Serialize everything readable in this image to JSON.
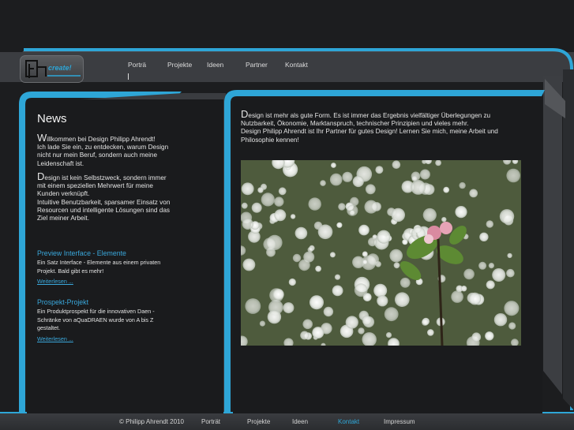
{
  "logo": {
    "text": "create!"
  },
  "topnav": {
    "items": [
      "Porträ",
      "Projekte",
      "Ideen",
      "Partner",
      "Kontakt"
    ]
  },
  "news": {
    "title": "News",
    "intro_p1_cap": "W",
    "intro_p1": "illkommen bei Design Philipp Ahrendt!\nIch lade Sie ein, zu entdecken, warum Design\nnicht nur mein Beruf, sondern auch meine\nLeidenschaft ist.",
    "intro_p2_cap": "D",
    "intro_p2": "esign ist kein Selbstzweck, sondern immer\nmit einem speziellen Mehrwert für meine\nKunden verknüpft.\nIntuitive Benutzbarkeit, sparsamer Einsatz von\nResourcen und intelligente Lösungen sind das\nZiel meiner Arbeit.",
    "posts": [
      {
        "title": "Preview Interface - Elemente",
        "body": "Ein Satz Interface - Elemente aus einem privaten\nProjekt. Bald gibt es mehr!",
        "link": "Weiterlesen ..."
      },
      {
        "title": "Prospekt-Projekt",
        "body": "Ein Produktprospekt für die innovativen Daen -\nSchränke von aQuaDRAEN wurde von A bis Z\ngestaltet.",
        "link": "Weiterlesen ..."
      }
    ]
  },
  "main": {
    "intro_cap": "D",
    "intro": "esign ist mehr als gute Form. Es ist immer das Ergebnis vielfältiger Überlegungen zu\nNutzbarkeit, Ökonomie, Marktanspruch, technischer Prinzipien und vieles mehr.\nDesign Philipp Ahrendt ist Ihr Partner für gutes Design! Lernen Sie mich, meine Arbeit und\nPhilosophie kennen!"
  },
  "footer": {
    "copyright": "© Philipp Ahrendt 2010",
    "links": [
      "Porträt",
      "Projekte",
      "Ideen",
      "Kontakt",
      "Impressum"
    ],
    "active_link": "Kontakt"
  },
  "colors": {
    "accent": "#2ea6d7",
    "background": "#1c1d1f",
    "panel": "#1a1b1d"
  }
}
